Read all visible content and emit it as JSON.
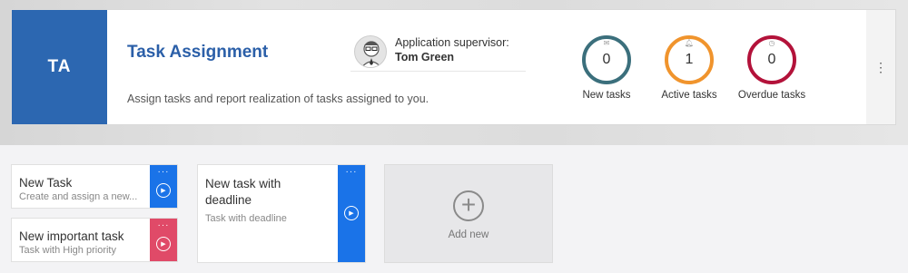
{
  "app": {
    "initials": "TA",
    "title": "Task Assignment",
    "description": "Assign tasks and report realization of tasks assigned to you.",
    "supervisor_label": "Application supervisor:",
    "supervisor_name": "Tom Green"
  },
  "stats": [
    {
      "label": "New tasks",
      "value": "0",
      "color": "#3b6f7c",
      "icon": "envelope-icon"
    },
    {
      "label": "Active tasks",
      "value": "1",
      "color": "#f0942d",
      "icon": "bell-icon"
    },
    {
      "label": "Overdue tasks",
      "value": "0",
      "color": "#b3123a",
      "icon": "clock-icon"
    }
  ],
  "menu_icon": "⋮",
  "tiles": [
    {
      "title": "New Task",
      "subtitle": "Create and assign a new...",
      "color": "#1a73e8"
    },
    {
      "title": "New important task",
      "subtitle": "Task with High priority",
      "color": "#e04a68"
    },
    {
      "title": "New task with deadline",
      "subtitle": "Task with deadline",
      "color": "#1a73e8"
    }
  ],
  "add_new_label": "Add new"
}
